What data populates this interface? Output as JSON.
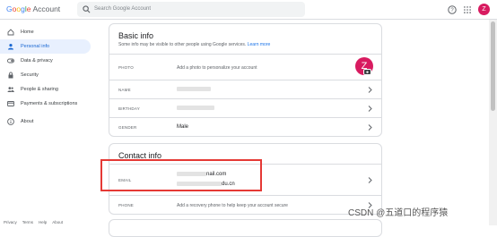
{
  "header": {
    "logo_letters": [
      "G",
      "o",
      "o",
      "g",
      "l",
      "e"
    ],
    "logo_account": "Account",
    "search_placeholder": "Search Google Account",
    "avatar_letter": "Z"
  },
  "sidebar": {
    "items": [
      {
        "label": "Home",
        "icon": "home-icon"
      },
      {
        "label": "Personal info",
        "icon": "person-icon",
        "active": true
      },
      {
        "label": "Data & privacy",
        "icon": "toggle-icon"
      },
      {
        "label": "Security",
        "icon": "lock-icon"
      },
      {
        "label": "People & sharing",
        "icon": "people-icon"
      },
      {
        "label": "Payments & subscriptions",
        "icon": "card-icon"
      },
      {
        "label": "About",
        "icon": "info-icon"
      }
    ],
    "footer": [
      "Privacy",
      "Terms",
      "Help",
      "About"
    ]
  },
  "basic_info": {
    "title": "Basic info",
    "subtitle": "Some info may be visible to other people using Google services.",
    "learn_more": "Learn more",
    "photo_label": "PHOTO",
    "photo_hint": "Add a photo to personalize your account",
    "photo_letter": "Z",
    "name_label": "NAME",
    "birthday_label": "BIRTHDAY",
    "gender_label": "GENDER",
    "gender_value": "Male"
  },
  "contact_info": {
    "title": "Contact info",
    "email_label": "EMAIL",
    "email_1_suffix": "nail.com",
    "email_2_suffix": "du.cn",
    "phone_label": "PHONE",
    "phone_hint": "Add a recovery phone to help keep your account secure"
  },
  "watermark": "CSDN @五道口的程序猿",
  "colors": {
    "accent": "#1a73e8",
    "avatar": "#d81b60",
    "highlight": "#e53935",
    "active_nav_bg": "#e8f0fe"
  }
}
